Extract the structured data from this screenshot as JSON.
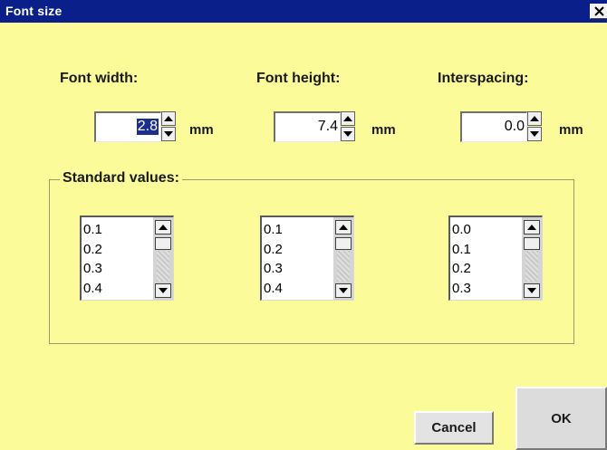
{
  "window": {
    "title": "Font size"
  },
  "fields": [
    {
      "label": "Font width:",
      "value": "2.8",
      "unit": "mm",
      "selected": true
    },
    {
      "label": "Font height:",
      "value": "7.4",
      "unit": "mm",
      "selected": false
    },
    {
      "label": "Interspacing:",
      "value": "0.0",
      "unit": "mm",
      "selected": false
    }
  ],
  "standard": {
    "label": "Standard values:",
    "lists": [
      {
        "items": [
          "0.1",
          "0.2",
          "0.3",
          "0.4"
        ]
      },
      {
        "items": [
          "0.1",
          "0.2",
          "0.3",
          "0.4"
        ]
      },
      {
        "items": [
          "0.0",
          "0.1",
          "0.2",
          "0.3"
        ]
      }
    ]
  },
  "buttons": {
    "cancel": "Cancel",
    "ok": "OK"
  },
  "colors": {
    "background": "#fbfb9a",
    "titlebar": "#0a1f8a",
    "selection": "#1c2f8c"
  }
}
